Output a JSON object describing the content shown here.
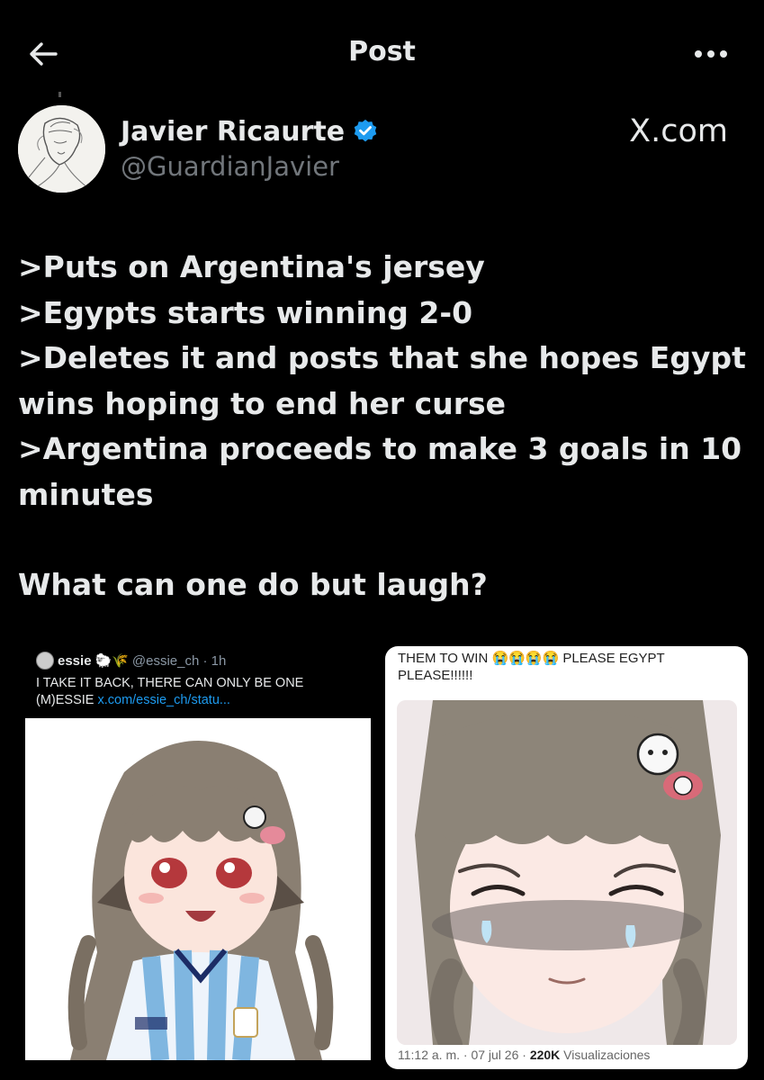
{
  "header": {
    "title": "Post"
  },
  "author": {
    "name": "Javier Ricaurte",
    "handle": "@GuardianJavier",
    "source": "X.com"
  },
  "post": {
    "lines": [
      ">Puts on Argentina's jersey",
      ">Egypts starts winning 2-0",
      ">Deletes it and posts that she hopes Egypt",
      "wins hoping to end her curse",
      ">Argentina proceeds to make 3 goals in 10",
      "minutes"
    ],
    "closing": "What can one do but laugh?"
  },
  "embed_left": {
    "name": "essie",
    "badges": "🐑🌾",
    "handle_time": "@essie_ch · 1h",
    "text": "I TAKE IT BACK, THERE CAN ONLY BE ONE (M)ESSIE ",
    "link": "x.com/essie_ch/statu..."
  },
  "embed_right": {
    "text": "THEM TO WIN 😭😭😭😭 PLEASE EGYPT PLEASE!!!!!!",
    "footer_time": "11:12 a. m. · 07 jul 26 · ",
    "footer_views": "220K",
    "footer_label": " Visualizaciones"
  },
  "icons": {
    "back": "arrow-left-icon",
    "more": "more-horizontal-icon",
    "verified": "verified-badge-icon"
  },
  "colors": {
    "background": "#000000",
    "text": "#e7e9ea",
    "secondary": "#71767b",
    "verified": "#1d9bf0"
  }
}
